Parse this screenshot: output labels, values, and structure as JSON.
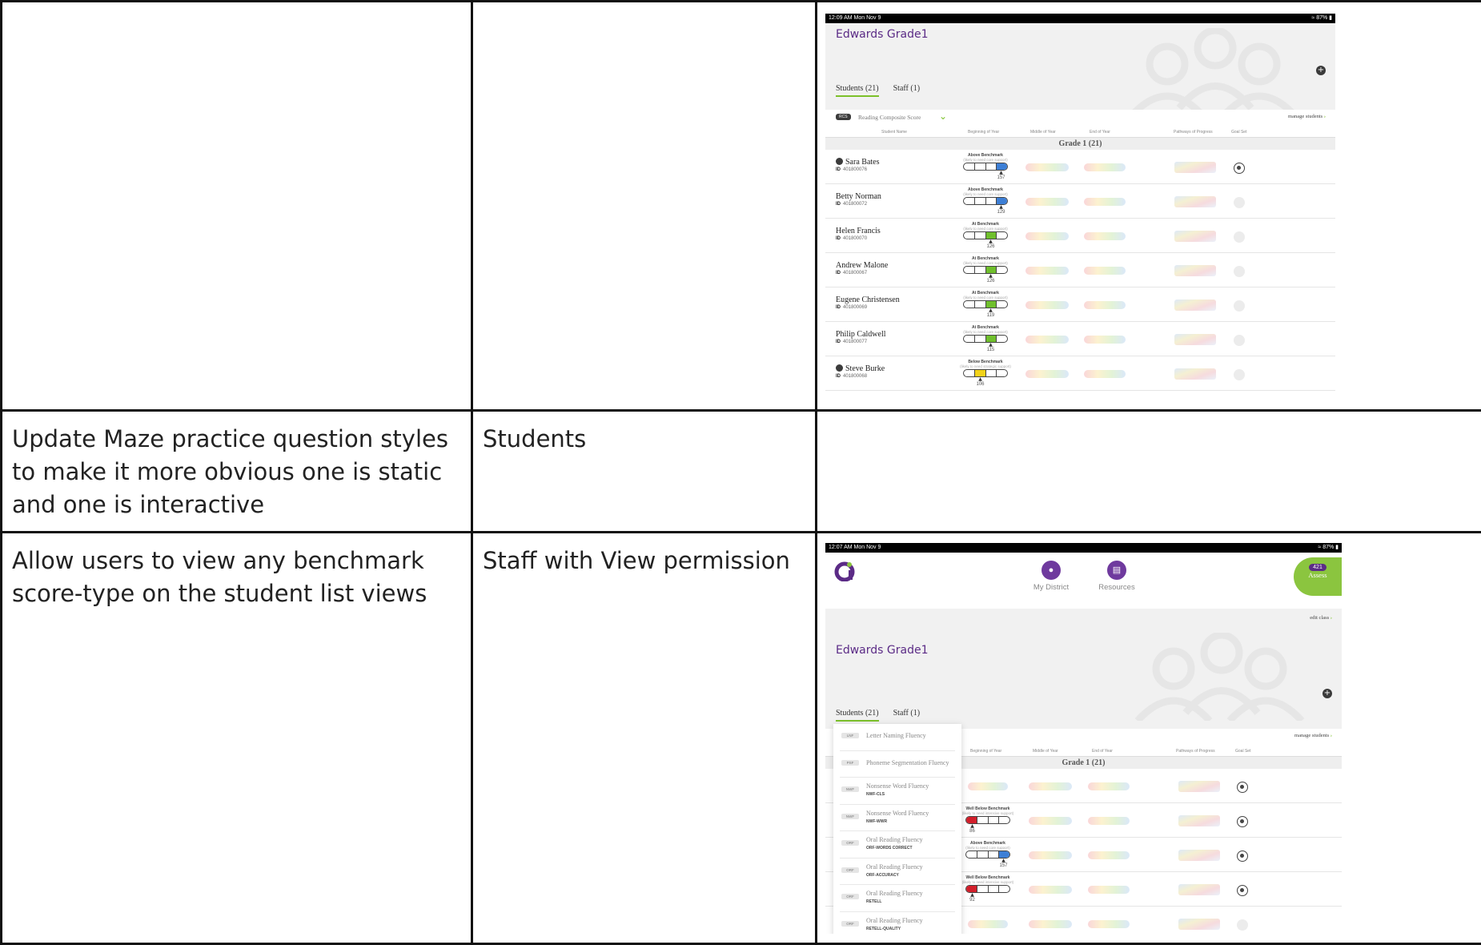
{
  "rows": [
    {
      "feature": "",
      "users": ""
    },
    {
      "feature": "Update Maze practice question styles to make it more obvious one is static and one is interactive",
      "users": "Students"
    },
    {
      "feature": "Allow users to view any benchmark score-type on the student list views",
      "users": "Staff with View permission"
    }
  ],
  "shot1": {
    "status_time": "12:09 AM   Mon Nov 9",
    "status_right": "87%",
    "class_title": "Edwards Grade1",
    "tab_students": "Students (21)",
    "tab_staff": "Staff (1)",
    "filter_badge": "RCS",
    "filter_label": "Reading Composite Score",
    "manage_label": "manage students",
    "col_name": "Student Name",
    "col_boy": "Beginning of Year",
    "col_moy": "Middle of Year",
    "col_eoy": "End of Year",
    "col_pop": "Pathways of Progress",
    "col_goal": "Goal Set",
    "grade_band": "Grade 1 (21)",
    "id_prefix": "ID",
    "students": [
      {
        "name": "Sara Bates",
        "id": "401800076",
        "flag": true,
        "bench": "Above Benchmark",
        "sub": "(likely to need core support)",
        "score": "157",
        "level": 3,
        "color": "#3d7fd6",
        "goal": true
      },
      {
        "name": "Betty Norman",
        "id": "401800072",
        "flag": false,
        "bench": "Above Benchmark",
        "sub": "(likely to need core support)",
        "score": "129",
        "level": 3,
        "color": "#3d7fd6",
        "goal": false
      },
      {
        "name": "Helen Francis",
        "id": "401800070",
        "flag": false,
        "bench": "At Benchmark",
        "sub": "(likely to need core support)",
        "score": "126",
        "level": 2,
        "color": "#6fbf2c",
        "goal": false
      },
      {
        "name": "Andrew Malone",
        "id": "401800067",
        "flag": false,
        "bench": "At Benchmark",
        "sub": "(likely to need core support)",
        "score": "126",
        "level": 2,
        "color": "#6fbf2c",
        "goal": false
      },
      {
        "name": "Eugene Christensen",
        "id": "401800069",
        "flag": false,
        "bench": "At Benchmark",
        "sub": "(likely to need core support)",
        "score": "119",
        "level": 2,
        "color": "#6fbf2c",
        "goal": false
      },
      {
        "name": "Philip Caldwell",
        "id": "401800077",
        "flag": false,
        "bench": "At Benchmark",
        "sub": "(likely to need core support)",
        "score": "115",
        "level": 2,
        "color": "#6fbf2c",
        "goal": false
      },
      {
        "name": "Steve Burke",
        "id": "401800068",
        "flag": true,
        "bench": "Below Benchmark",
        "sub": "(likely to need strategic support)",
        "score": "106",
        "level": 1,
        "color": "#f2d21a",
        "goal": false
      }
    ]
  },
  "shot2": {
    "status_time": "12:07 AM   Mon Nov 9",
    "status_right": "87%",
    "nav_district": "My District",
    "nav_resources": "Resources",
    "assess_count": "421",
    "assess_label": "Assess",
    "edit_class": "edit class",
    "class_title": "Edwards Grade1",
    "tab_students": "Students (21)",
    "tab_staff": "Staff (1)",
    "manage_label": "manage students",
    "col_boy": "Beginning of Year",
    "col_moy": "Middle of Year",
    "col_eoy": "End of Year",
    "col_pop": "Pathways of Progress",
    "col_goal": "Goal Set",
    "grade_band": "Grade 1 (21)",
    "measures": [
      {
        "tag": "LNF",
        "name": "Letter Naming Fluency",
        "sub": ""
      },
      {
        "tag": "PSF",
        "name": "Phoneme Segmentation Fluency",
        "sub": ""
      },
      {
        "tag": "NWF",
        "name": "Nonsense Word Fluency",
        "sub": "NWF-CLS"
      },
      {
        "tag": "NWF",
        "name": "Nonsense Word Fluency",
        "sub": "NWF-WWR"
      },
      {
        "tag": "ORF",
        "name": "Oral Reading Fluency",
        "sub": "ORF-WORDS CORRECT"
      },
      {
        "tag": "ORF",
        "name": "Oral Reading Fluency",
        "sub": "ORF-ACCURACY"
      },
      {
        "tag": "ORF",
        "name": "Oral Reading Fluency",
        "sub": "RETELL"
      },
      {
        "tag": "ORF",
        "name": "Oral Reading Fluency",
        "sub": "RETELL-QUALITY"
      }
    ],
    "rows": [
      {
        "bench": "",
        "sub": "",
        "score": "",
        "level": -1,
        "color": "",
        "goal": true
      },
      {
        "bench": "Well Below Benchmark",
        "sub": "(likely to need intensive support)",
        "score": "86",
        "level": 0,
        "color": "#d21f2b",
        "goal": true
      },
      {
        "bench": "Above Benchmark",
        "sub": "(likely to need core support)",
        "score": "157",
        "level": 3,
        "color": "#3d7fd6",
        "goal": true
      },
      {
        "bench": "Well Below Benchmark",
        "sub": "(likely to need intensive support)",
        "score": "92",
        "level": 0,
        "color": "#d21f2b",
        "goal": true
      },
      {
        "bench": "",
        "sub": "",
        "score": "",
        "level": -1,
        "color": "",
        "goal": false
      }
    ]
  },
  "colors": {
    "purple": "#5b2b86",
    "green": "#8bc53f",
    "blue": "#3d7fd6",
    "red": "#d21f2b",
    "yellow": "#f2d21a"
  },
  "icons": {
    "add": "plus-circle-icon",
    "district": "map-pin-icon",
    "resources": "document-icon",
    "assess": "clipboard-icon"
  }
}
